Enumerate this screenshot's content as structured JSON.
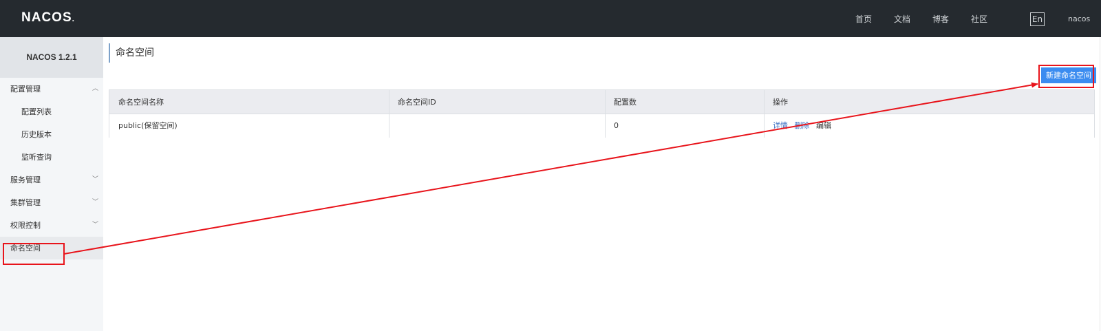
{
  "header": {
    "logo": "NACOS",
    "logo_suffix": ".",
    "nav": [
      "首页",
      "文档",
      "博客",
      "社区"
    ],
    "lang": "En",
    "user": "nacos"
  },
  "sidebar": {
    "version": "NACOS 1.2.1",
    "items": [
      {
        "label": "配置管理",
        "level": "top",
        "chevron": "up"
      },
      {
        "label": "配置列表",
        "level": "sub"
      },
      {
        "label": "历史版本",
        "level": "sub"
      },
      {
        "label": "监听查询",
        "level": "sub"
      },
      {
        "label": "服务管理",
        "level": "top",
        "chevron": "down"
      },
      {
        "label": "集群管理",
        "level": "top",
        "chevron": "down"
      },
      {
        "label": "权限控制",
        "level": "top",
        "chevron": "down"
      },
      {
        "label": "命名空间",
        "level": "top",
        "active": true
      }
    ]
  },
  "main": {
    "title": "命名空间",
    "new_button": "新建命名空间",
    "table": {
      "headers": [
        "命名空间名称",
        "命名空间ID",
        "配置数",
        "操作"
      ],
      "rows": [
        {
          "name": "public(保留空间)",
          "id": "",
          "count": "0",
          "actions": [
            "详情",
            "删除",
            "编辑"
          ]
        }
      ]
    }
  },
  "annotation": {
    "color": "#e8141b"
  }
}
